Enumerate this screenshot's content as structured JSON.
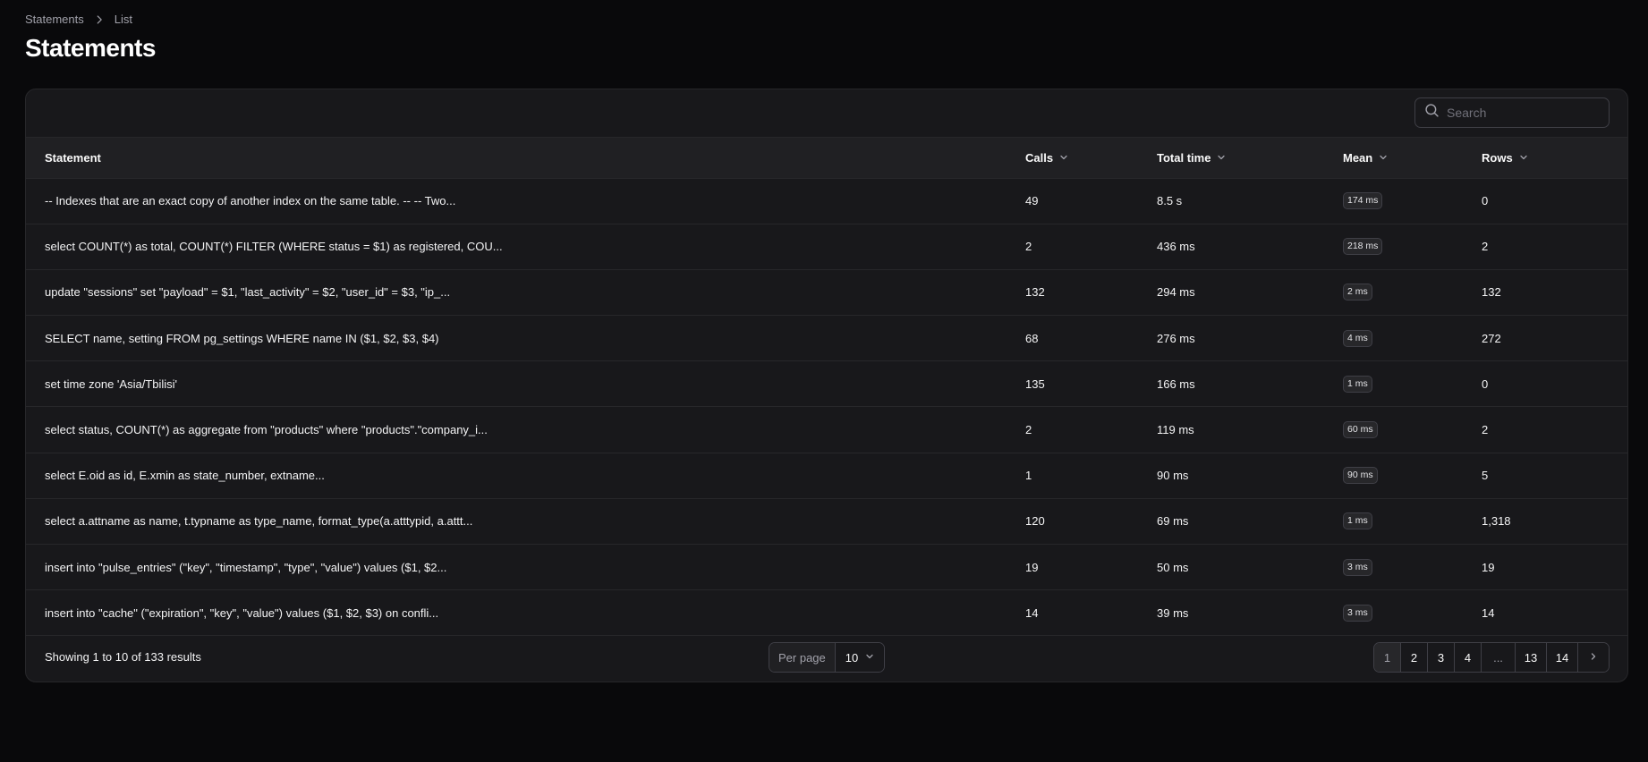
{
  "breadcrumb": {
    "parent": "Statements",
    "current": "List"
  },
  "page_title": "Statements",
  "search": {
    "placeholder": "Search",
    "value": ""
  },
  "columns": {
    "statement": "Statement",
    "calls": "Calls",
    "total_time": "Total time",
    "mean": "Mean",
    "rows": "Rows"
  },
  "rows": [
    {
      "statement": "-- Indexes that are an exact copy of another index on the same table. -- -- Two...",
      "calls": "49",
      "total_time": "8.5 s",
      "mean": "174 ms",
      "rows": "0"
    },
    {
      "statement": "select COUNT(*) as total, COUNT(*) FILTER (WHERE status = $1) as registered, COU...",
      "calls": "2",
      "total_time": "436 ms",
      "mean": "218 ms",
      "rows": "2"
    },
    {
      "statement": "update \"sessions\" set \"payload\" = $1, \"last_activity\" = $2, \"user_id\" = $3, \"ip_...",
      "calls": "132",
      "total_time": "294 ms",
      "mean": "2 ms",
      "rows": "132"
    },
    {
      "statement": "SELECT name, setting FROM pg_settings WHERE name IN ($1, $2, $3, $4)",
      "calls": "68",
      "total_time": "276 ms",
      "mean": "4 ms",
      "rows": "272"
    },
    {
      "statement": "set time zone 'Asia/Tbilisi'",
      "calls": "135",
      "total_time": "166 ms",
      "mean": "1 ms",
      "rows": "0"
    },
    {
      "statement": "select status, COUNT(*) as aggregate from \"products\" where \"products\".\"company_i...",
      "calls": "2",
      "total_time": "119 ms",
      "mean": "60 ms",
      "rows": "2"
    },
    {
      "statement": "select E.oid as id, E.xmin as state_number, extname...",
      "calls": "1",
      "total_time": "90 ms",
      "mean": "90 ms",
      "rows": "5"
    },
    {
      "statement": "select a.attname as name, t.typname as type_name, format_type(a.atttypid, a.attt...",
      "calls": "120",
      "total_time": "69 ms",
      "mean": "1 ms",
      "rows": "1,318"
    },
    {
      "statement": "insert into \"pulse_entries\" (\"key\", \"timestamp\", \"type\", \"value\") values ($1, $2...",
      "calls": "19",
      "total_time": "50 ms",
      "mean": "3 ms",
      "rows": "19"
    },
    {
      "statement": "insert into \"cache\" (\"expiration\", \"key\", \"value\") values ($1, $2, $3) on confli...",
      "calls": "14",
      "total_time": "39 ms",
      "mean": "3 ms",
      "rows": "14"
    }
  ],
  "footer": {
    "results_text": "Showing 1 to 10 of 133 results",
    "per_page_label": "Per page",
    "per_page_value": "10",
    "pages": [
      "1",
      "2",
      "3",
      "4",
      "...",
      "13",
      "14"
    ],
    "current_page": "1"
  },
  "icons": {
    "search": "search-icon",
    "breadcrumb_separator": "chevron-right-icon",
    "sort": "chevron-down-icon",
    "per_page_dropdown": "chevron-down-icon",
    "next_page": "chevron-right-icon"
  },
  "colors": {
    "background": "#09090b",
    "card": "#18181b",
    "border": "#27272a",
    "text": "#fafafa",
    "muted": "#a1a1aa"
  }
}
